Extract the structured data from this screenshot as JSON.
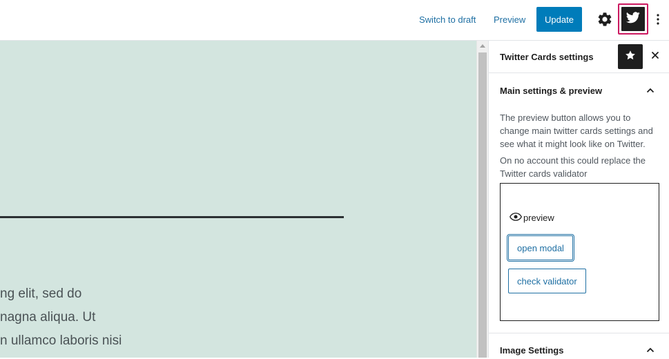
{
  "topbar": {
    "switch_to_draft": "Switch to draft",
    "preview": "Preview",
    "update": "Update",
    "settings_icon": "gear-icon",
    "twitter_icon": "twitter-bird-icon",
    "more_icon": "vertical-ellipsis-icon"
  },
  "editor": {
    "lines": [
      "ng elit, sed do",
      "nagna aliqua. Ut",
      "n ullamco laboris nisi"
    ],
    "background_color": "#d3e5df"
  },
  "sidebar": {
    "title": "Twitter Cards settings",
    "star_icon": "star-icon",
    "close_icon": "close-icon",
    "panels": [
      {
        "title": "Main settings & preview",
        "expanded": true,
        "description_1": "The preview button allows you to change main twitter cards settings and see what it might look like on Twitter.",
        "description_2": "On no account this could replace the Twitter cards validator",
        "preview_label": "preview",
        "open_modal": "open modal",
        "check_validator": "check validator"
      },
      {
        "title": "Image Settings",
        "expanded": true
      }
    ]
  },
  "colors": {
    "accent": "#007cba",
    "link": "#1e6fa3",
    "highlight": "#cc1960",
    "dark": "#1e1e1e"
  }
}
